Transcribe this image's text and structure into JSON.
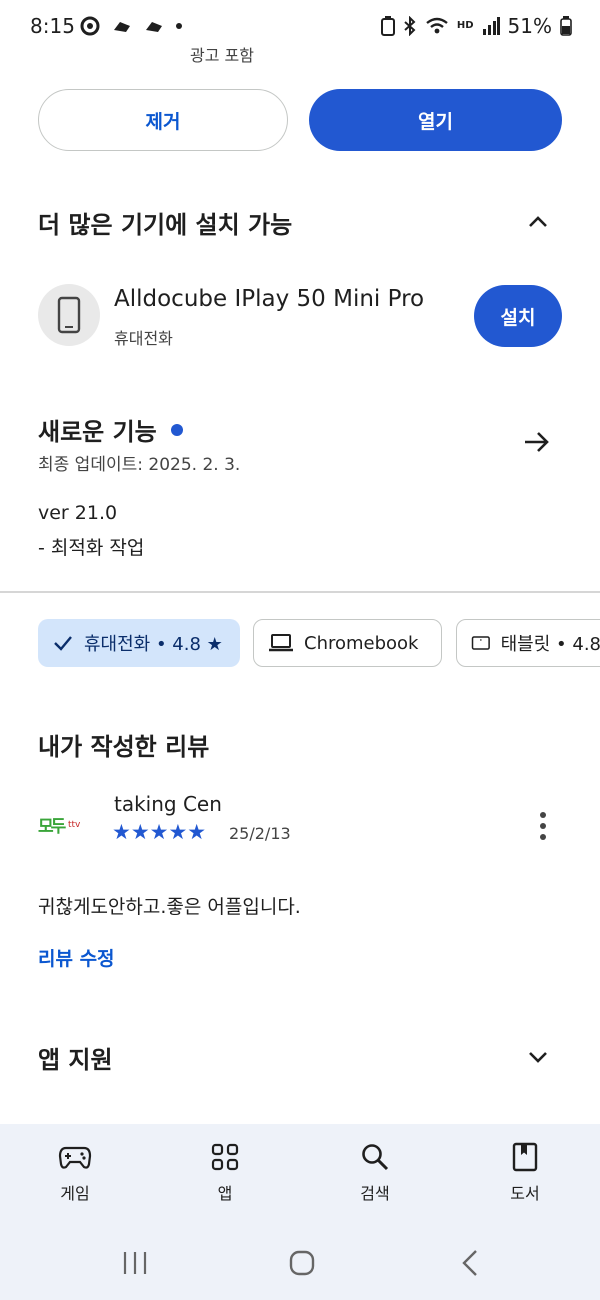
{
  "status_bar": {
    "time": "8:15",
    "battery": "51%",
    "hd_label": "HD"
  },
  "ad_label": "광고 포함",
  "actions": {
    "uninstall": "제거",
    "open": "열기"
  },
  "more_devices": {
    "title": "더 많은 기기에 설치 가능",
    "device_name": "Alldocube IPlay 50 Mini Pro",
    "device_type": "휴대전화",
    "install": "설치"
  },
  "whats_new": {
    "title": "새로운 기능",
    "updated": "최종 업데이트: 2025. 2. 3.",
    "version": "ver 21.0",
    "note": "- 최적화 작업"
  },
  "device_chips": [
    {
      "label": "휴대전화 • 4.8 ★",
      "selected": true
    },
    {
      "label": "Chromebook",
      "selected": false
    },
    {
      "label": "태블릿 • 4.8",
      "selected": false
    }
  ],
  "my_review": {
    "title": "내가 작성한 리뷰",
    "reviewer": "taking Cen",
    "rating": 5,
    "stars": "★★★★★",
    "date": "25/2/13",
    "text": "귀찮게도안하고.좋은 어플입니다.",
    "edit": "리뷰 수정",
    "avatar_text": "모두",
    "avatar_sub": "ttv"
  },
  "app_support": {
    "title": "앱 지원"
  },
  "bottom_nav": [
    {
      "label": "게임",
      "icon": "gamepad-icon"
    },
    {
      "label": "앱",
      "icon": "apps-grid-icon"
    },
    {
      "label": "검색",
      "icon": "search-icon"
    },
    {
      "label": "도서",
      "icon": "book-icon"
    }
  ],
  "colors": {
    "accent": "#2258d1",
    "link": "#0b57d0",
    "chip_selected": "#d3e5fb",
    "nav_bg": "#eef2f9"
  }
}
